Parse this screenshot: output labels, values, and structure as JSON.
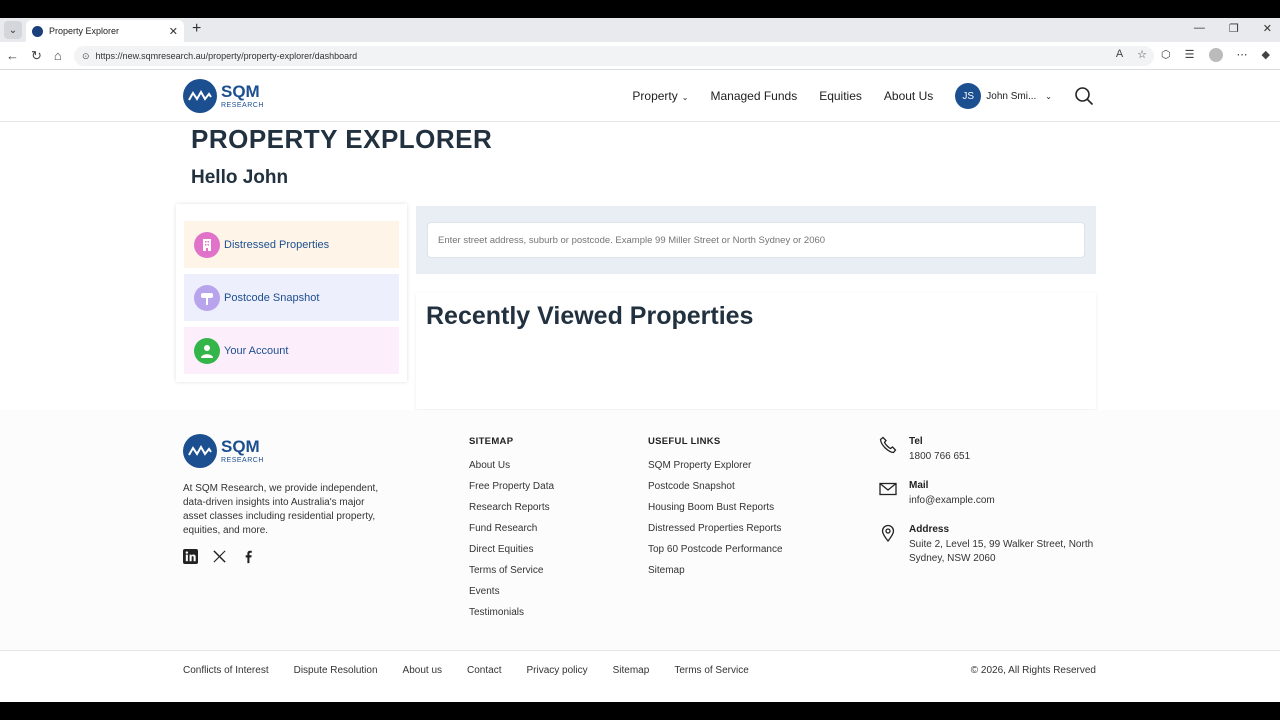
{
  "browser": {
    "tab_title": "Property Explorer",
    "url": "https://new.sqmresearch.au/property/property-explorer/dashboard"
  },
  "header": {
    "logo_text": "SQM",
    "logo_sub": "RESEARCH",
    "nav": [
      "Property",
      "Managed Funds",
      "Equities",
      "About Us"
    ],
    "user_initials": "JS",
    "user_name": "John Smi..."
  },
  "main": {
    "title": "PROPERTY EXPLORER",
    "greeting": "Hello John",
    "sidebar": [
      {
        "label": "Distressed Properties",
        "icon": "building-icon"
      },
      {
        "label": "Postcode Snapshot",
        "icon": "signpost-icon"
      },
      {
        "label": "Your Account",
        "icon": "user-icon"
      }
    ],
    "search_placeholder": "Enter street address, suburb or postcode. Example 99 Miller Street or North Sydney or 2060",
    "recent_title": "Recently Viewed Properties"
  },
  "footer": {
    "about": "At SQM Research, we provide independent, data-driven insights into Australia's major asset classes including residential property, equities, and more.",
    "sitemap_title": "SITEMAP",
    "sitemap": [
      "About Us",
      "Free Property Data",
      "Research Reports",
      "Fund Research",
      "Direct Equities",
      "Terms of Service",
      "Events",
      "Testimonials"
    ],
    "links_title": "USEFUL LINKS",
    "links": [
      "SQM Property Explorer",
      "Postcode Snapshot",
      "Housing Boom Bust Reports",
      "Distressed Properties Reports",
      "Top 60 Postcode Performance",
      "Sitemap"
    ],
    "tel_label": "Tel",
    "tel": "1800 766 651",
    "mail_label": "Mail",
    "mail": "info@example.com",
    "address_label": "Address",
    "address": "Suite 2, Level 15, 99 Walker Street, North Sydney, NSW 2060",
    "bottom_links": [
      "Conflicts of Interest",
      "Dispute Resolution",
      "About us",
      "Contact",
      "Privacy policy",
      "Sitemap",
      "Terms of Service"
    ],
    "copyright": "© 2026, All Rights Reserved"
  },
  "colors": {
    "brand": "#1c4f8f",
    "text": "#22313f"
  }
}
